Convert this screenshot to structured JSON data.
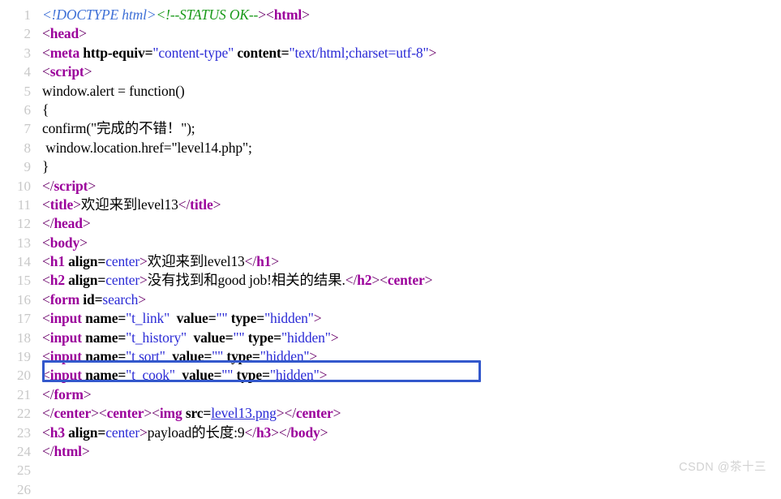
{
  "page": {
    "kind": "browser-view-source",
    "background_color": "#ffffff",
    "gutter_color": "#c8c8c8",
    "text_color": "#000000"
  },
  "colors": {
    "tag": "#9b009b",
    "bracket": "#6a006a",
    "attr_name": "#000000",
    "attr_value": "#2b2bd6",
    "comment": "#1a9a1a",
    "doctype": "#3d6fd6",
    "link": "#2b2bd6",
    "highlight_box": "#3358cc",
    "watermark": "#d2d2d2"
  },
  "annotation": {
    "type": "rectangle-highlight",
    "target_line": 20,
    "color": "#3358cc",
    "label": "highlight-box-line-20"
  },
  "watermark": {
    "text": "CSDN @茶十三"
  },
  "lines": [
    {
      "number": "1",
      "tokens": [
        {
          "t": "doctype",
          "s": "<!DOCTYPE html>"
        },
        {
          "t": "comment",
          "s": "<!--STATUS OK--"
        },
        {
          "t": "bracket",
          "s": ">"
        },
        {
          "t": "bracket",
          "s": "<"
        },
        {
          "t": "tag",
          "s": "html"
        },
        {
          "t": "bracket",
          "s": ">"
        }
      ]
    },
    {
      "number": "2",
      "tokens": [
        {
          "t": "bracket",
          "s": "<"
        },
        {
          "t": "tag",
          "s": "head"
        },
        {
          "t": "bracket",
          "s": ">"
        }
      ]
    },
    {
      "number": "3",
      "tokens": [
        {
          "t": "bracket",
          "s": "<"
        },
        {
          "t": "tag",
          "s": "meta"
        },
        {
          "t": "plain",
          "s": " "
        },
        {
          "t": "attrname",
          "s": "http-equiv"
        },
        {
          "t": "attrname",
          "s": "="
        },
        {
          "t": "attrval",
          "s": "\"content-type\""
        },
        {
          "t": "plain",
          "s": " "
        },
        {
          "t": "attrname",
          "s": "content"
        },
        {
          "t": "attrname",
          "s": "="
        },
        {
          "t": "attrval",
          "s": "\"text/html;charset=utf-8\""
        },
        {
          "t": "bracket",
          "s": ">"
        }
      ]
    },
    {
      "number": "4",
      "tokens": [
        {
          "t": "bracket",
          "s": "<"
        },
        {
          "t": "tag",
          "s": "script"
        },
        {
          "t": "bracket",
          "s": ">"
        }
      ]
    },
    {
      "number": "5",
      "tokens": [
        {
          "t": "text",
          "s": "window.alert = function()"
        }
      ]
    },
    {
      "number": "6",
      "tokens": [
        {
          "t": "text",
          "s": "{"
        }
      ]
    },
    {
      "number": "7",
      "tokens": [
        {
          "t": "text",
          "s": "confirm(\"完成的不错！\");"
        }
      ]
    },
    {
      "number": "8",
      "tokens": [
        {
          "t": "text",
          "s": " window.location.href=\"level14.php\";"
        }
      ]
    },
    {
      "number": "9",
      "tokens": [
        {
          "t": "text",
          "s": "}"
        }
      ]
    },
    {
      "number": "10",
      "tokens": [
        {
          "t": "bracket",
          "s": "</"
        },
        {
          "t": "tag",
          "s": "script"
        },
        {
          "t": "bracket",
          "s": ">"
        }
      ]
    },
    {
      "number": "11",
      "tokens": [
        {
          "t": "bracket",
          "s": "<"
        },
        {
          "t": "tag",
          "s": "title"
        },
        {
          "t": "bracket",
          "s": ">"
        },
        {
          "t": "text",
          "s": "欢迎来到level13"
        },
        {
          "t": "bracket",
          "s": "</"
        },
        {
          "t": "tag",
          "s": "title"
        },
        {
          "t": "bracket",
          "s": ">"
        }
      ]
    },
    {
      "number": "12",
      "tokens": [
        {
          "t": "bracket",
          "s": "</"
        },
        {
          "t": "tag",
          "s": "head"
        },
        {
          "t": "bracket",
          "s": ">"
        }
      ]
    },
    {
      "number": "13",
      "tokens": [
        {
          "t": "bracket",
          "s": "<"
        },
        {
          "t": "tag",
          "s": "body"
        },
        {
          "t": "bracket",
          "s": ">"
        }
      ]
    },
    {
      "number": "14",
      "tokens": [
        {
          "t": "bracket",
          "s": "<"
        },
        {
          "t": "tag",
          "s": "h1"
        },
        {
          "t": "plain",
          "s": " "
        },
        {
          "t": "attrname",
          "s": "align"
        },
        {
          "t": "attrname",
          "s": "="
        },
        {
          "t": "attrval",
          "s": "center"
        },
        {
          "t": "bracket",
          "s": ">"
        },
        {
          "t": "text",
          "s": "欢迎来到level13"
        },
        {
          "t": "bracket",
          "s": "</"
        },
        {
          "t": "tag",
          "s": "h1"
        },
        {
          "t": "bracket",
          "s": ">"
        }
      ]
    },
    {
      "number": "15",
      "tokens": [
        {
          "t": "bracket",
          "s": "<"
        },
        {
          "t": "tag",
          "s": "h2"
        },
        {
          "t": "plain",
          "s": " "
        },
        {
          "t": "attrname",
          "s": "align"
        },
        {
          "t": "attrname",
          "s": "="
        },
        {
          "t": "attrval",
          "s": "center"
        },
        {
          "t": "bracket",
          "s": ">"
        },
        {
          "t": "text",
          "s": "没有找到和good job!相关的结果."
        },
        {
          "t": "bracket",
          "s": "</"
        },
        {
          "t": "tag",
          "s": "h2"
        },
        {
          "t": "bracket",
          "s": ">"
        },
        {
          "t": "bracket",
          "s": "<"
        },
        {
          "t": "tag",
          "s": "center"
        },
        {
          "t": "bracket",
          "s": ">"
        }
      ]
    },
    {
      "number": "16",
      "tokens": [
        {
          "t": "bracket",
          "s": "<"
        },
        {
          "t": "tag",
          "s": "form"
        },
        {
          "t": "plain",
          "s": " "
        },
        {
          "t": "attrname",
          "s": "id"
        },
        {
          "t": "attrname",
          "s": "="
        },
        {
          "t": "attrval",
          "s": "search"
        },
        {
          "t": "bracket",
          "s": ">"
        }
      ]
    },
    {
      "number": "17",
      "tokens": [
        {
          "t": "bracket",
          "s": "<"
        },
        {
          "t": "tag",
          "s": "input"
        },
        {
          "t": "plain",
          "s": " "
        },
        {
          "t": "attrname",
          "s": "name"
        },
        {
          "t": "attrname",
          "s": "="
        },
        {
          "t": "attrval",
          "s": "\"t_link\""
        },
        {
          "t": "plain",
          "s": "  "
        },
        {
          "t": "attrname",
          "s": "value"
        },
        {
          "t": "attrname",
          "s": "="
        },
        {
          "t": "attrval",
          "s": "\"\""
        },
        {
          "t": "plain",
          "s": " "
        },
        {
          "t": "attrname",
          "s": "type"
        },
        {
          "t": "attrname",
          "s": "="
        },
        {
          "t": "attrval",
          "s": "\"hidden\""
        },
        {
          "t": "bracket",
          "s": ">"
        }
      ]
    },
    {
      "number": "18",
      "tokens": [
        {
          "t": "bracket",
          "s": "<"
        },
        {
          "t": "tag",
          "s": "input"
        },
        {
          "t": "plain",
          "s": " "
        },
        {
          "t": "attrname",
          "s": "name"
        },
        {
          "t": "attrname",
          "s": "="
        },
        {
          "t": "attrval",
          "s": "\"t_history\""
        },
        {
          "t": "plain",
          "s": "  "
        },
        {
          "t": "attrname",
          "s": "value"
        },
        {
          "t": "attrname",
          "s": "="
        },
        {
          "t": "attrval",
          "s": "\"\""
        },
        {
          "t": "plain",
          "s": " "
        },
        {
          "t": "attrname",
          "s": "type"
        },
        {
          "t": "attrname",
          "s": "="
        },
        {
          "t": "attrval",
          "s": "\"hidden\""
        },
        {
          "t": "bracket",
          "s": ">"
        }
      ]
    },
    {
      "number": "19",
      "tokens": [
        {
          "t": "bracket",
          "s": "<"
        },
        {
          "t": "tag",
          "s": "input"
        },
        {
          "t": "plain",
          "s": " "
        },
        {
          "t": "attrname",
          "s": "name"
        },
        {
          "t": "attrname",
          "s": "="
        },
        {
          "t": "attrval",
          "s": "\"t sort\""
        },
        {
          "t": "plain",
          "s": "  "
        },
        {
          "t": "attrname",
          "s": "value"
        },
        {
          "t": "attrname",
          "s": "="
        },
        {
          "t": "attrval",
          "s": "\"\""
        },
        {
          "t": "plain",
          "s": " "
        },
        {
          "t": "attrname",
          "s": "type"
        },
        {
          "t": "attrname",
          "s": "="
        },
        {
          "t": "attrval",
          "s": "\"hidden\""
        },
        {
          "t": "bracket",
          "s": ">"
        }
      ]
    },
    {
      "number": "20",
      "highlighted": true,
      "tokens": [
        {
          "t": "bracket",
          "s": "<"
        },
        {
          "t": "tag",
          "s": "input"
        },
        {
          "t": "plain",
          "s": " "
        },
        {
          "t": "attrname",
          "s": "name"
        },
        {
          "t": "attrname",
          "s": "="
        },
        {
          "t": "attrval",
          "s": "\"t_cook\""
        },
        {
          "t": "plain",
          "s": "  "
        },
        {
          "t": "attrname",
          "s": "value"
        },
        {
          "t": "attrname",
          "s": "="
        },
        {
          "t": "attrval",
          "s": "\"\""
        },
        {
          "t": "plain",
          "s": " "
        },
        {
          "t": "attrname",
          "s": "type"
        },
        {
          "t": "attrname",
          "s": "="
        },
        {
          "t": "attrval",
          "s": "\"hidden\""
        },
        {
          "t": "bracket",
          "s": ">"
        }
      ]
    },
    {
      "number": "21",
      "tokens": [
        {
          "t": "bracket",
          "s": "</"
        },
        {
          "t": "tag",
          "s": "form"
        },
        {
          "t": "bracket",
          "s": ">"
        }
      ]
    },
    {
      "number": "22",
      "tokens": [
        {
          "t": "bracket",
          "s": "</"
        },
        {
          "t": "tag",
          "s": "center"
        },
        {
          "t": "bracket",
          "s": ">"
        },
        {
          "t": "bracket",
          "s": "<"
        },
        {
          "t": "tag",
          "s": "center"
        },
        {
          "t": "bracket",
          "s": ">"
        },
        {
          "t": "bracket",
          "s": "<"
        },
        {
          "t": "tag",
          "s": "img"
        },
        {
          "t": "plain",
          "s": " "
        },
        {
          "t": "attrname",
          "s": "src"
        },
        {
          "t": "attrname",
          "s": "="
        },
        {
          "t": "link",
          "s": "level13.png"
        },
        {
          "t": "bracket",
          "s": ">"
        },
        {
          "t": "bracket",
          "s": "</"
        },
        {
          "t": "tag",
          "s": "center"
        },
        {
          "t": "bracket",
          "s": ">"
        }
      ]
    },
    {
      "number": "23",
      "tokens": [
        {
          "t": "bracket",
          "s": "<"
        },
        {
          "t": "tag",
          "s": "h3"
        },
        {
          "t": "plain",
          "s": " "
        },
        {
          "t": "attrname",
          "s": "align"
        },
        {
          "t": "attrname",
          "s": "="
        },
        {
          "t": "attrval",
          "s": "center"
        },
        {
          "t": "bracket",
          "s": ">"
        },
        {
          "t": "text",
          "s": "payload的长度:9"
        },
        {
          "t": "bracket",
          "s": "</"
        },
        {
          "t": "tag",
          "s": "h3"
        },
        {
          "t": "bracket",
          "s": ">"
        },
        {
          "t": "bracket",
          "s": "</"
        },
        {
          "t": "tag",
          "s": "body"
        },
        {
          "t": "bracket",
          "s": ">"
        }
      ]
    },
    {
      "number": "24",
      "tokens": [
        {
          "t": "bracket",
          "s": "</"
        },
        {
          "t": "tag",
          "s": "html"
        },
        {
          "t": "bracket",
          "s": ">"
        }
      ]
    },
    {
      "number": "25",
      "tokens": []
    },
    {
      "number": "26",
      "tokens": []
    }
  ]
}
